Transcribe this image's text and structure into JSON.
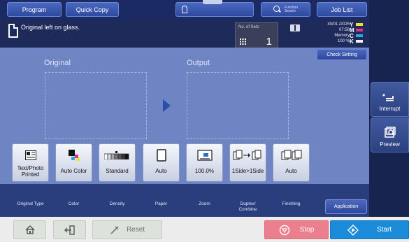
{
  "top_bar": {
    "program_label": "Program",
    "quick_copy_label": "Quick Copy",
    "func_search_label": "Function\nSearch",
    "job_list_label": "Job List"
  },
  "status": {
    "message": "Original left on glass.",
    "sets_label": "No. of Sets",
    "sets_value": "1",
    "date": "30/01 /2025",
    "time": "07:58",
    "memory_label": "Memory",
    "memory_value": "100 %",
    "toner": [
      {
        "letter": "Y",
        "color": "#f2e12c"
      },
      {
        "letter": "M",
        "color": "#e0338f"
      },
      {
        "letter": "C",
        "color": "#2fa6de"
      },
      {
        "letter": "K",
        "color": "#f2f2f2"
      }
    ],
    "check_setting_label": "Check Setting"
  },
  "main": {
    "original_label": "Original",
    "output_label": "Output"
  },
  "side": {
    "interrupt_label": "Interrupt",
    "preview_label": "Preview"
  },
  "functions": [
    {
      "value": "Text/Photo\nPrinted",
      "label": "Original Type",
      "icon": "original-type-icon"
    },
    {
      "value": "Auto Color",
      "label": "Color",
      "icon": "color-icon"
    },
    {
      "value": "Standard",
      "label": "Density",
      "icon": "density-icon"
    },
    {
      "value": "Auto",
      "label": "Paper",
      "icon": "paper-icon"
    },
    {
      "value": "100.0%",
      "label": "Zoom",
      "icon": "zoom-icon"
    },
    {
      "value": "1Side>1Side",
      "label": "Duplex/\nCombine",
      "icon": "duplex-icon"
    },
    {
      "value": "Auto",
      "label": "Finishing",
      "icon": "finishing-icon"
    }
  ],
  "application_label": "Application",
  "bottom": {
    "reset_label": "Reset",
    "stop_label": "Stop",
    "start_label": "Start"
  },
  "colors": {
    "main_bg": "#6f84c3",
    "stop": "#eb7f8e",
    "start": "#1a8bd8"
  }
}
